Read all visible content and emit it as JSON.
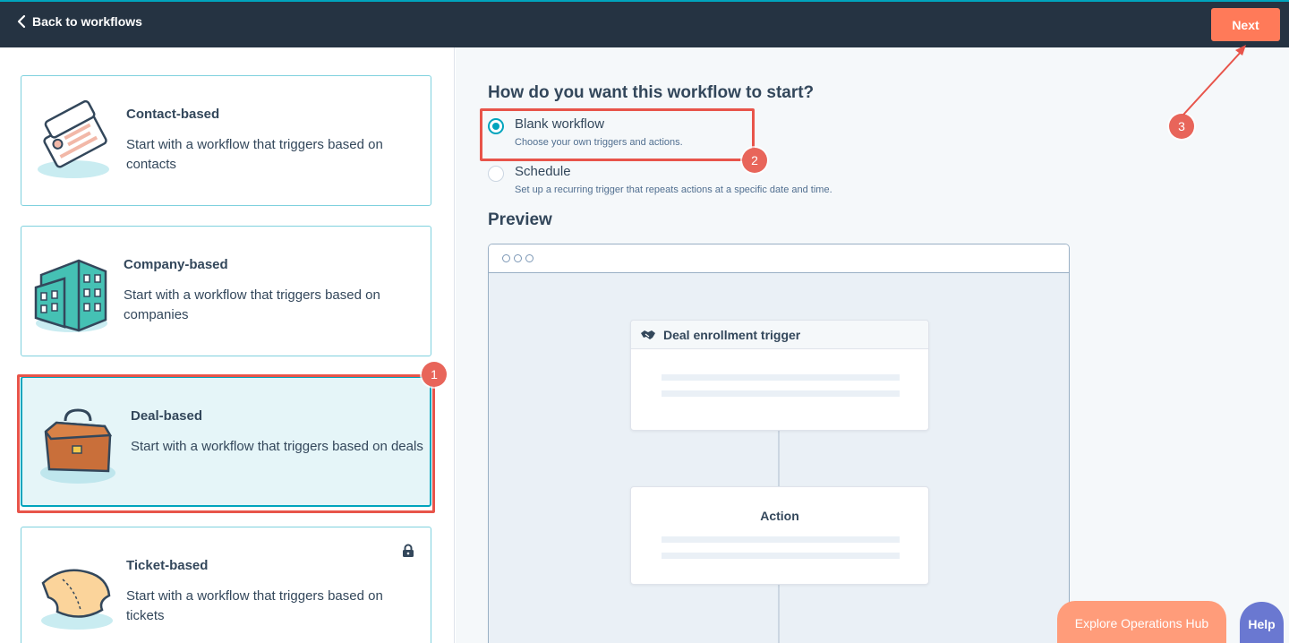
{
  "header": {
    "back_label": "Back to workflows",
    "next_label": "Next"
  },
  "cards": [
    {
      "title": "Contact-based",
      "desc": "Start with a workflow that triggers based on contacts",
      "icon": "contact-card-icon"
    },
    {
      "title": "Company-based",
      "desc": "Start with a workflow that triggers based on companies",
      "icon": "building-icon"
    },
    {
      "title": "Deal-based",
      "desc": "Start with a workflow that triggers based on deals",
      "icon": "briefcase-icon"
    },
    {
      "title": "Ticket-based",
      "desc": "Start with a workflow that triggers based on tickets",
      "icon": "ticket-icon"
    }
  ],
  "start": {
    "question": "How do you want this workflow to start?",
    "options": [
      {
        "label": "Blank workflow",
        "sub": "Choose your own triggers and actions.",
        "checked": true
      },
      {
        "label": "Schedule",
        "sub": "Set up a recurring trigger that repeats actions at a specific date and time.",
        "checked": false
      }
    ]
  },
  "preview": {
    "title": "Preview",
    "trigger_label": "Deal enrollment trigger",
    "action_label": "Action"
  },
  "annotations": {
    "badge1": "1",
    "badge2": "2",
    "badge3": "3"
  },
  "footer": {
    "explore_label": "Explore Operations Hub",
    "help_label": "Help"
  },
  "colors": {
    "accent": "#00a4bd",
    "primary_button": "#ff7a59",
    "annotation": "#e8544a",
    "nav_bg": "#253342"
  }
}
